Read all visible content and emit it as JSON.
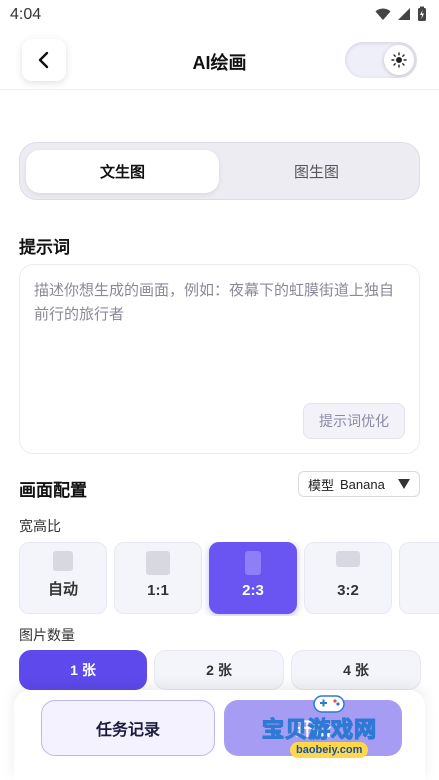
{
  "status_bar": {
    "time": "4:04"
  },
  "header": {
    "title": "AI绘画"
  },
  "mode_tabs": [
    {
      "label": "文生图",
      "active": true
    },
    {
      "label": "图生图",
      "active": false
    }
  ],
  "prompt": {
    "label": "提示词",
    "placeholder": "描述你想生成的画面，例如：夜幕下的虹膜街道上独自前行的旅行者",
    "optimize_label": "提示词优化"
  },
  "config": {
    "label": "画面配置",
    "model_prefix": "模型",
    "model_value": "Banana"
  },
  "aspect": {
    "label": "宽高比",
    "options": [
      {
        "label": "自动",
        "active": false
      },
      {
        "label": "1:1",
        "active": false
      },
      {
        "label": "2:3",
        "active": true
      },
      {
        "label": "3:2",
        "active": false
      }
    ]
  },
  "count": {
    "label": "图片数量",
    "options": [
      {
        "label": "1 张",
        "active": true
      },
      {
        "label": "2 张",
        "active": false
      },
      {
        "label": "4 张",
        "active": false
      }
    ]
  },
  "actions": {
    "task_label": "任务记录",
    "start_label": "开始"
  },
  "watermark": {
    "text": "宝贝游戏网",
    "url": "baobeiy.com"
  },
  "colors": {
    "accent": "#5e49ec",
    "accent_light": "#a79cf4"
  }
}
